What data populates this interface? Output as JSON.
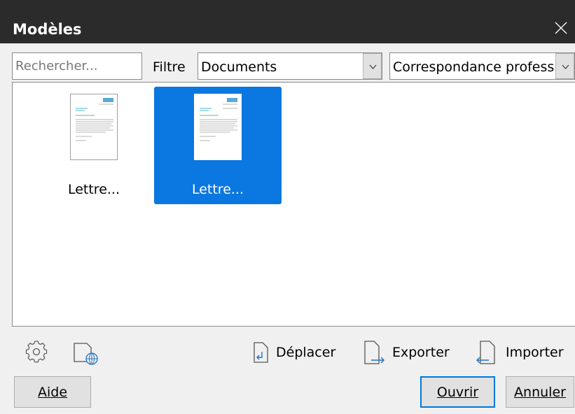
{
  "window": {
    "title": "Modèles"
  },
  "toolbar": {
    "search_placeholder": "Rechercher...",
    "filter_label": "Filtre",
    "filter_value": "Documents",
    "category_value": "Correspondance professionnelle"
  },
  "templates": [
    {
      "label": "Lettre...",
      "selected": false
    },
    {
      "label": "Lettre...",
      "selected": true
    }
  ],
  "actions": {
    "move_label": "Déplacer",
    "export_label": "Exporter",
    "import_label": "Importer"
  },
  "buttons": {
    "help": "Aide",
    "open": "Ouvrir",
    "cancel": "Annuler"
  },
  "colors": {
    "selection": "#0b77e0",
    "titlebar": "#2b2b2b",
    "accent": "#0078d7"
  },
  "icons": [
    "close-icon",
    "chevron-down-icon",
    "gear-icon",
    "remote-server-icon",
    "move-icon",
    "export-icon",
    "import-icon"
  ]
}
